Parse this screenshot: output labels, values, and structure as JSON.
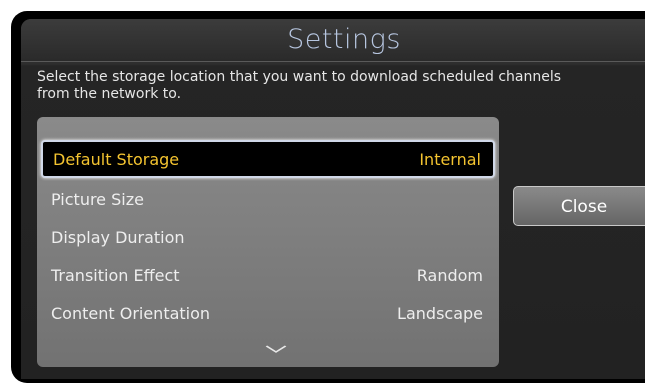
{
  "dialog": {
    "title": "Settings",
    "description": "Select the storage location that you want to download scheduled channels from the network to."
  },
  "list": {
    "items": [
      {
        "label": "Default Storage",
        "value": "Internal",
        "selected": true
      },
      {
        "label": "Picture Size",
        "value": ""
      },
      {
        "label": "Display Duration",
        "value": ""
      },
      {
        "label": "Transition Effect",
        "value": "Random"
      },
      {
        "label": "Content Orientation",
        "value": "Landscape"
      }
    ],
    "more_indicator_icon": "chevron-down-icon"
  },
  "buttons": {
    "close_label": "Close"
  },
  "colors": {
    "selected_text": "#f4c430",
    "title_text": "#b7c6e0",
    "panel_background": "#7f7f7f"
  }
}
